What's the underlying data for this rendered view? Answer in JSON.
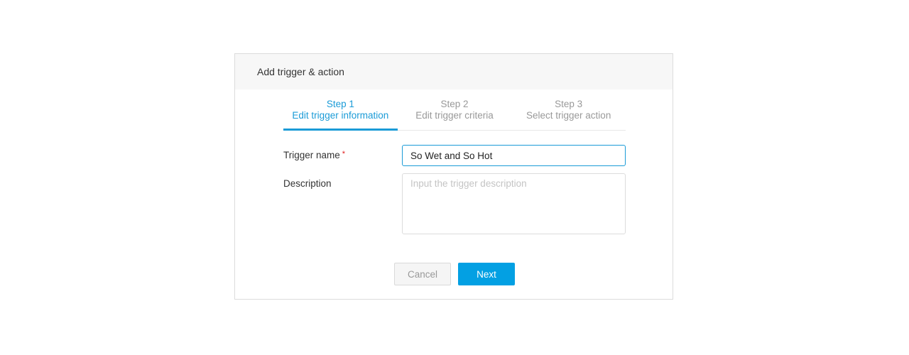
{
  "dialog": {
    "title": "Add trigger & action"
  },
  "steps": [
    {
      "step": "Step 1",
      "label": "Edit trigger information",
      "active": true
    },
    {
      "step": "Step 2",
      "label": "Edit trigger criteria",
      "active": false
    },
    {
      "step": "Step 3",
      "label": "Select trigger action",
      "active": false
    }
  ],
  "form": {
    "trigger_name_label": "Trigger name",
    "required_mark": "*",
    "trigger_name_value": "So Wet and So Hot",
    "description_label": "Description",
    "description_placeholder": "Input the trigger description",
    "description_value": ""
  },
  "buttons": {
    "cancel": "Cancel",
    "next": "Next"
  },
  "colors": {
    "accent": "#1a9bd7",
    "primary_button": "#03a0e3",
    "required": "#e02020"
  }
}
